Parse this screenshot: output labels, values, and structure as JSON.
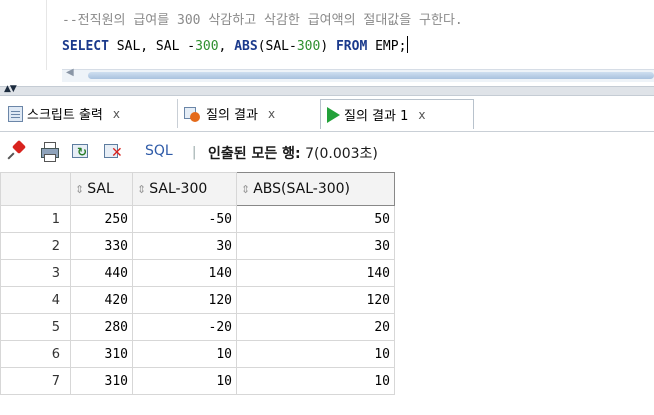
{
  "editor": {
    "comment_line": "--전직원의 급여를 300 삭감하고 삭감한 급여액의 절대값을 구한다.",
    "sql": {
      "kw_select": "SELECT",
      "part1": " SAL, SAL -",
      "num1": "300",
      "part2": ", ",
      "kw_abs": "ABS",
      "part3": "(SAL-",
      "num2": "300",
      "part4": ") ",
      "kw_from": "FROM",
      "part5": " EMP;"
    }
  },
  "tabs": [
    {
      "label": "스크립트 출력",
      "close": "x",
      "icon": "script-output-icon"
    },
    {
      "label": "질의 결과",
      "close": "x",
      "icon": "query-result-icon"
    },
    {
      "label": "질의 결과 1",
      "close": "x",
      "icon": "run-statement-icon"
    }
  ],
  "toolbar": {
    "sql_label": "SQL",
    "separator": "|",
    "fetch_label": "인출된 모든 행:",
    "fetch_value": " 7(0.003초)",
    "icons": [
      "pin-icon",
      "print-icon",
      "refresh-icon",
      "cancel-query-icon"
    ]
  },
  "grid": {
    "columns": [
      "SAL",
      "SAL-300",
      "ABS(SAL-300)"
    ],
    "rows": [
      {
        "n": "1",
        "cells": [
          "250",
          "-50",
          "50"
        ]
      },
      {
        "n": "2",
        "cells": [
          "330",
          "30",
          "30"
        ]
      },
      {
        "n": "3",
        "cells": [
          "440",
          "140",
          "140"
        ]
      },
      {
        "n": "4",
        "cells": [
          "420",
          "120",
          "120"
        ]
      },
      {
        "n": "5",
        "cells": [
          "280",
          "-20",
          "20"
        ]
      },
      {
        "n": "6",
        "cells": [
          "310",
          "10",
          "10"
        ]
      },
      {
        "n": "7",
        "cells": [
          "310",
          "10",
          "10"
        ]
      }
    ]
  },
  "colors": {
    "keyword": "#1b3a8c",
    "number": "#2f8f2f",
    "comment": "#8a8a8a",
    "sql_link": "#2f5ba8"
  }
}
